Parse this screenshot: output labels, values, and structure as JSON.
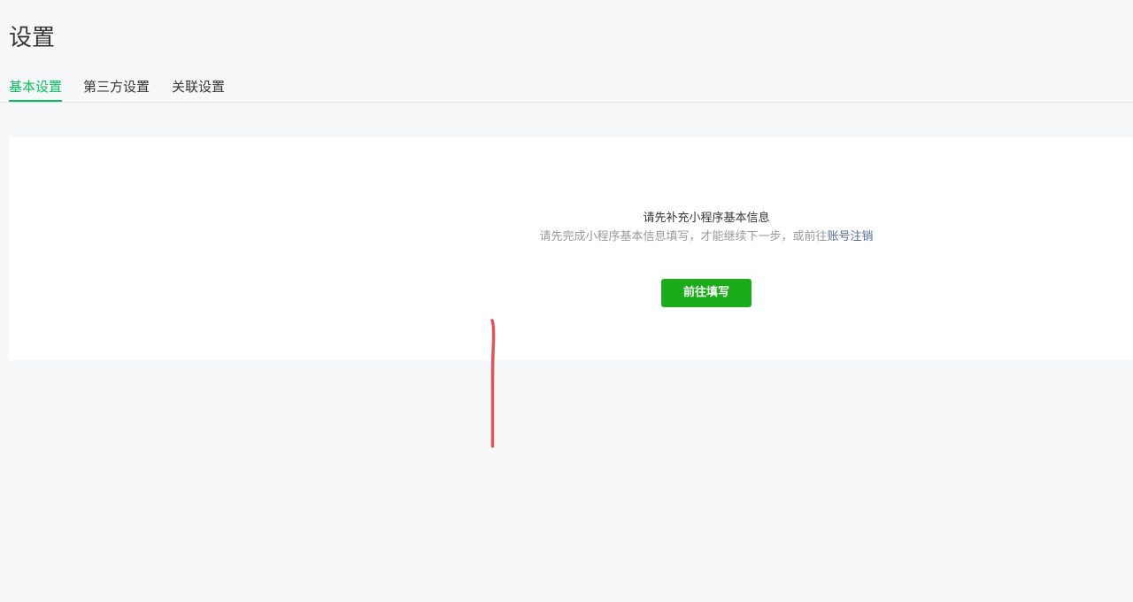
{
  "page": {
    "title": "设置"
  },
  "tabs": [
    {
      "label": "基本设置",
      "active": true
    },
    {
      "label": "第三方设置",
      "active": false
    },
    {
      "label": "关联设置",
      "active": false
    }
  ],
  "notice": {
    "title": "请先补充小程序基本信息",
    "description": "请先完成小程序基本信息填写，才能继续下一步，或前往",
    "link_label": "账号注销",
    "button_label": "前往填写"
  },
  "colors": {
    "accent": "#07c160",
    "button": "#1aad19",
    "link": "#576b95",
    "annotation": "#e05656"
  }
}
